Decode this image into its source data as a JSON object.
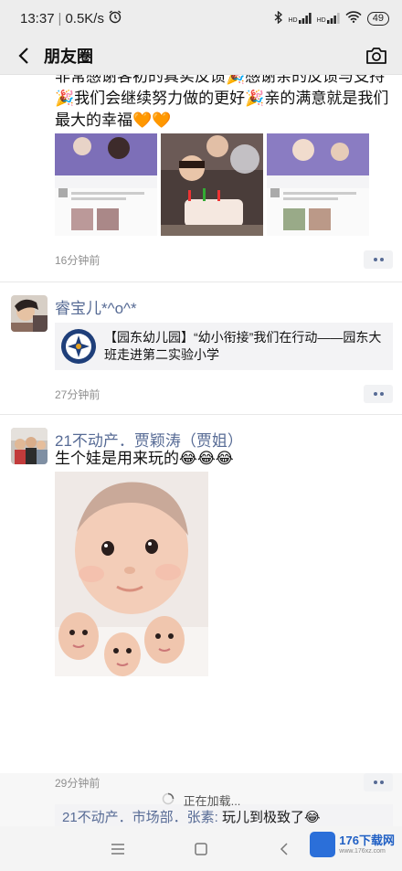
{
  "status": {
    "time": "13:37",
    "speed": "0.5K/s",
    "battery": "49",
    "signal1": "HD",
    "signal2": "HD"
  },
  "nav": {
    "title": "朋友圈",
    "back_icon": "chevron-left-icon",
    "camera_icon": "camera-icon"
  },
  "posts": [
    {
      "text": "非常感谢客初的真实反馈🎉感谢亲的反馈与支持🎉我们会继续努力做的更好🎉亲的满意就是我们最大的幸福🧡🧡",
      "time": "16分钟前"
    },
    {
      "name": "睿宝儿*^o^*",
      "link_text": "【园东幼儿园】“幼小衔接”我们在行动——园东大班走进第二实验小学",
      "time": "27分钟前"
    },
    {
      "name": "21不动产．贾颖涛（贾姐）",
      "text": "生个娃是用来玩的😂😂😂",
      "time": "29分钟前",
      "comment_name": "21不动产．市场部．张素:",
      "comment_text": " 玩儿到极致了😂"
    }
  ],
  "loading_text": "正在加载...",
  "watermark": {
    "title": "176下载网",
    "subtitle": "www.176xz.com"
  },
  "colors": {
    "link_blue": "#576b95",
    "bg": "#f7f7f7"
  }
}
